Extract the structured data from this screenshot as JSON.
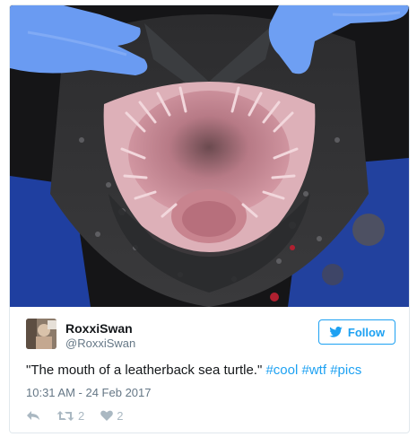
{
  "tweet": {
    "display_name": "RoxxiSwan",
    "handle": "@RoxxiSwan",
    "follow_label": "Follow",
    "text_quote": "\"The mouth of a leatherback sea turtle.\"",
    "hashtags": [
      "#cool",
      "#wtf",
      "#pics"
    ],
    "timestamp": "10:31 AM - 24 Feb 2017",
    "retweet_count": "2",
    "like_count": "2"
  },
  "colors": {
    "accent": "#1da1f2",
    "text": "#14171a",
    "muted": "#657786",
    "icon": "#aab8c2"
  },
  "icons": [
    "twitter-bird-icon",
    "reply-icon",
    "retweet-icon",
    "heart-icon"
  ]
}
